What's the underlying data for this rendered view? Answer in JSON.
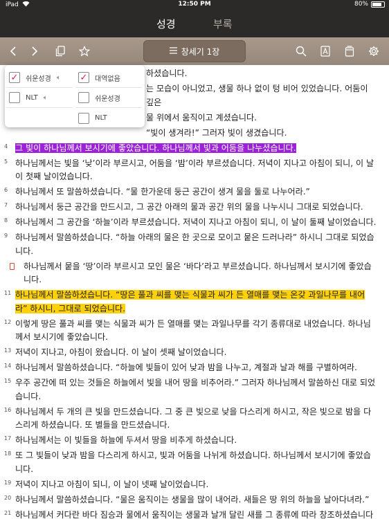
{
  "status": {
    "time": "12:50 PM",
    "carrier": "iPad",
    "battery": "80%",
    "battery_level": 0.8
  },
  "tabs": [
    {
      "label": "성경",
      "active": true
    },
    {
      "label": "부록",
      "active": false
    }
  ],
  "toolbar": {
    "chapter": "창세기 1장"
  },
  "popover": {
    "left": [
      {
        "label": "쉬운성경",
        "checked": true,
        "audio": true
      },
      {
        "label": "NLT",
        "checked": false,
        "audio": true
      }
    ],
    "right": [
      {
        "label": "대역없음",
        "checked": true
      },
      {
        "label": "쉬운성경",
        "checked": false
      },
      {
        "label": "NLT",
        "checked": false
      }
    ]
  },
  "verses": [
    {
      "num": "",
      "text": "하셨습니다."
    },
    {
      "num": "",
      "text": "는 모습이 아니었고, 생물 하나 없이 텅 비어 있었습니다. 어둠이 깊은"
    },
    {
      "num": "",
      "text": "물 위에서 움직이고 계셨습니다."
    },
    {
      "num": "",
      "text": "“빛이 생겨라!” 그러자 빛이 생겼습니다."
    },
    {
      "num": "4",
      "text": "그 빛이 하나님께서 보시기에 좋았습니다. 하나님께서 빛과 어둠을 나누셨습니다.",
      "highlight": "purple"
    },
    {
      "num": "5",
      "text": "하나님께서는 빛을 ‘낮’이라 부르시고, 어둠을 ‘밤’이라 부르셨습니다. 저녁이 지나고 아침이 되니, 이 날이 첫째 날이었습니다."
    },
    {
      "num": "6",
      "text": "하나님께서 또 말씀하셨습니다. “물 한가운데 둥근 공간이 생겨 물을 둘로 나누어라.”"
    },
    {
      "num": "7",
      "text": "하나님께서 둥근 공간을 만드시고, 그 공간 아래의 물과 공간 위의 물을 나누시니 그대로 되었습니다."
    },
    {
      "num": "8",
      "text": "하나님께서 그 공간을 ‘하늘’이라 부르셨습니다. 저녁이 지나고 아침이 되니, 이 날이 둘째 날이었습니다."
    },
    {
      "num": "9",
      "text": "하나님께서 말씀하셨습니다. “하늘 아래의 물은 한 곳으로 모이고 뭍은 드러나라” 하시니 그대로 되었습니다."
    },
    {
      "num": "",
      "text": "하나님께서 뭍을 ‘땅’이라 부르시고 모인 물은 ‘바다’라고 부르셨습니다. 하나님께서 보시기에 좋았습니다.",
      "bookmark": true
    },
    {
      "num": "11",
      "text": "하나님께서 말씀하셨습니다. “땅은 풀과 씨를 맺는 식물과 씨가 든 열매를 맺는 온갖 과일나무를 내어라” 하시니, 그대로 되었습니다.",
      "highlight": "yellow"
    },
    {
      "num": "12",
      "text": "이렇게 땅은 풀과 씨를 맺는 식물과 씨가 든 열매를 맺는 과일나무를 각기 종류대로 내었습니다. 하나님께서 보시기에 좋았습니다."
    },
    {
      "num": "13",
      "text": "저녁이 지나고, 아침이 왔습니다. 이 날이 셋째 날이었습니다."
    },
    {
      "num": "14",
      "text": "하나님께서 말씀하셨습니다. “하늘에 빛들이 있어 낮과 밤을 나누고, 계절과 날과 해를 구별하여라."
    },
    {
      "num": "15",
      "text": "우주 공간에 떠 있는 것들은 하늘에서 빛을 내어 땅을 비추어라.” 그러자 하나님께서 말씀하신 대로 되었습니다."
    },
    {
      "num": "16",
      "text": "하나님께서 두 개의 큰 빛을 만드셨습니다. 그 중 큰 빛으로 낮을 다스리게 하시고, 작은 빛으로 밤을 다스리게 하셨습니다. 또 별들을 만드셨습니다."
    },
    {
      "num": "17",
      "text": "하나님께서는 이 빛들을 하늘에 두셔서 땅을 비추게 하셨습니다."
    },
    {
      "num": "18",
      "text": "또 그 빛들이 낮과 밤을 다스리게 하시고, 빛과 어둠을 나뉘게 하셨습니다. 하나님께서 보시기에 좋았습니다."
    },
    {
      "num": "19",
      "text": "저녁이 지나고 아침이 되니, 이 날이 넷째 날이었습니다."
    },
    {
      "num": "20",
      "text": "하나님께서 말씀하셨습니다. “물은 움직이는 생물을 많이 내어라. 새들은 땅 위의 하늘을 날아다녀라.”"
    },
    {
      "num": "21",
      "text": "하나님께서 커다란 바다 짐승과 물에서 움직이는 생물과 날개 달린 새를 그 종류에 따라 창조하셨습니다"
    }
  ]
}
